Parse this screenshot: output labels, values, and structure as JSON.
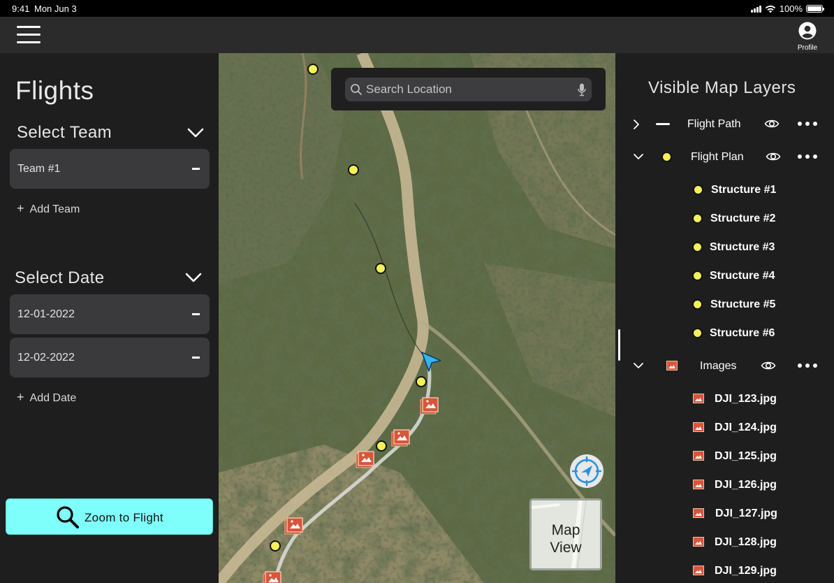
{
  "status_bar": {
    "time": "9:41",
    "date": "Mon Jun 3",
    "battery": "100%"
  },
  "topbar": {
    "profile_label": "Profile"
  },
  "left_panel": {
    "title": "Flights",
    "team_section": {
      "title": "Select Team",
      "items": [
        "Team #1"
      ],
      "add_label": "Add Team"
    },
    "date_section": {
      "title": "Select Date",
      "items": [
        "12-01-2022",
        "12-02-2022"
      ],
      "add_label": "Add Date"
    },
    "zoom_button_label": "Zoom to Flight"
  },
  "map": {
    "search_placeholder": "Search Location",
    "map_view_label_line1": "Map",
    "map_view_label_line2": "View"
  },
  "layers": {
    "title": "Visible Map Layers",
    "flight_path": "Flight Path",
    "flight_plan": "Flight Plan",
    "structures": [
      "Structure #1",
      "Structure #2",
      "Structure #3",
      "Structure #4",
      "Structure #5",
      "Structure #6"
    ],
    "images_label": "Images",
    "images": [
      "DJI_123.jpg",
      "DJI_124.jpg",
      "DJI_125.jpg",
      "DJI_126.jpg",
      "DJI_127.jpg",
      "DJI_128.jpg",
      "DJI_129.jpg"
    ]
  },
  "colors": {
    "accent_cyan": "#7efffb",
    "marker_yellow": "#f3f05a",
    "image_marker": "#d9553a",
    "nav_blue": "#2b8fdb"
  }
}
